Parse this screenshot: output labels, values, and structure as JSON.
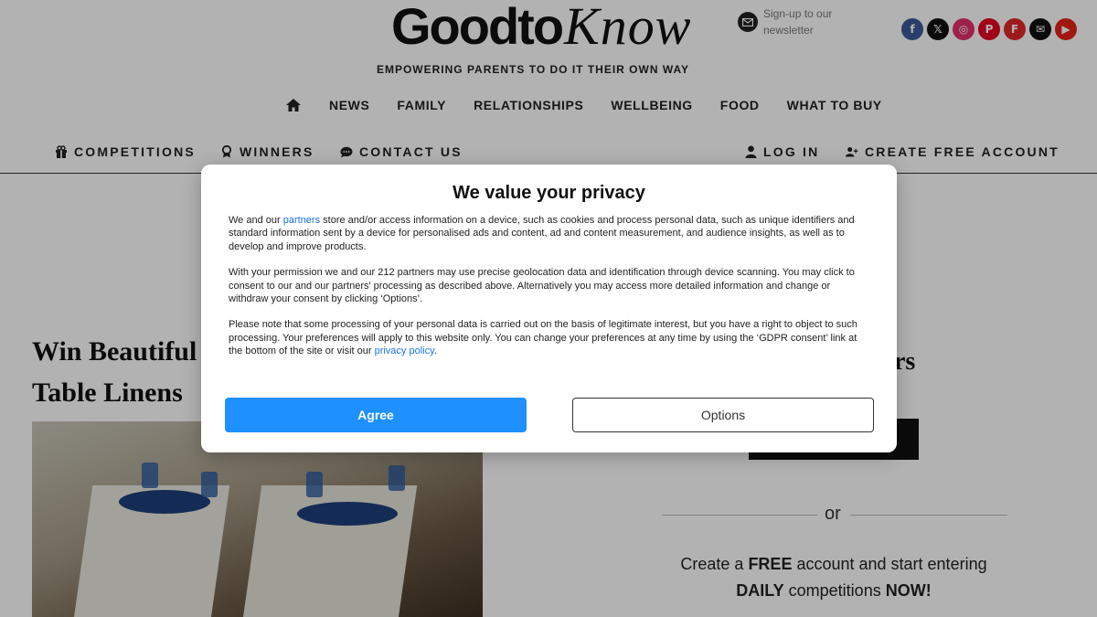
{
  "header": {
    "logo_main": "Goodto",
    "logo_script": "Know",
    "newsletter_text": "Sign-up to our newsletter",
    "tagline": "EMPOWERING PARENTS TO DO IT THEIR OWN WAY",
    "social": [
      {
        "icon": "facebook-icon",
        "glyph": "f",
        "color": "#3b5998"
      },
      {
        "icon": "x-icon",
        "glyph": "𝕏",
        "color": "#111111"
      },
      {
        "icon": "instagram-icon",
        "glyph": "◎",
        "color": "#e1306c"
      },
      {
        "icon": "pinterest-icon",
        "glyph": "P",
        "color": "#e60023"
      },
      {
        "icon": "flipboard-icon",
        "glyph": "F",
        "color": "#e12828"
      },
      {
        "icon": "email-icon",
        "glyph": "✉",
        "color": "#111111"
      },
      {
        "icon": "youtube-icon",
        "glyph": "▶",
        "color": "#e62117"
      }
    ]
  },
  "nav": {
    "items": [
      "NEWS",
      "FAMILY",
      "RELATIONSHIPS",
      "WELLBEING",
      "FOOD",
      "WHAT TO BUY"
    ]
  },
  "subnav": {
    "competitions": "COMPETITIONS",
    "winners": "WINNERS",
    "contact": "CONTACT US",
    "login": "LOG IN",
    "create_account": "CREATE FREE ACCOUNT"
  },
  "content": {
    "article_title_line1": "Win Beautiful",
    "article_title_line2": "Table Linens",
    "side_heading_fragment": "bers",
    "or_text": "or",
    "cta_part1": "Create a ",
    "cta_bold1": "FREE",
    "cta_part2": " account and start entering",
    "cta_bold2": "DAILY",
    "cta_part3": " competitions ",
    "cta_bold3": "NOW!"
  },
  "modal": {
    "title": "We value your privacy",
    "p1_before": "We and our ",
    "p1_link": "partners",
    "p1_after": " store and/or access information on a device, such as cookies and process personal data, such as unique identifiers and standard information sent by a device for personalised ads and content, ad and content measurement, and audience insights, as well as to develop and improve products.",
    "p2": "With your permission we and our 212 partners may use precise geolocation data and identification through device scanning. You may click to consent to our and our partners' processing as described above. Alternatively you may access more detailed information and change or withdraw your consent by clicking ‘Options’.",
    "p3_before": "Please note that some processing of your personal data is carried out on the basis of legitimate interest, but you have a right to object to such processing. Your preferences will apply to this website only. You can change your preferences at any time by using the ‘GDPR consent’ link at the bottom of the site or visit our ",
    "p3_link": "privacy policy",
    "p3_after": ".",
    "agree_label": "Agree",
    "options_label": "Options"
  }
}
